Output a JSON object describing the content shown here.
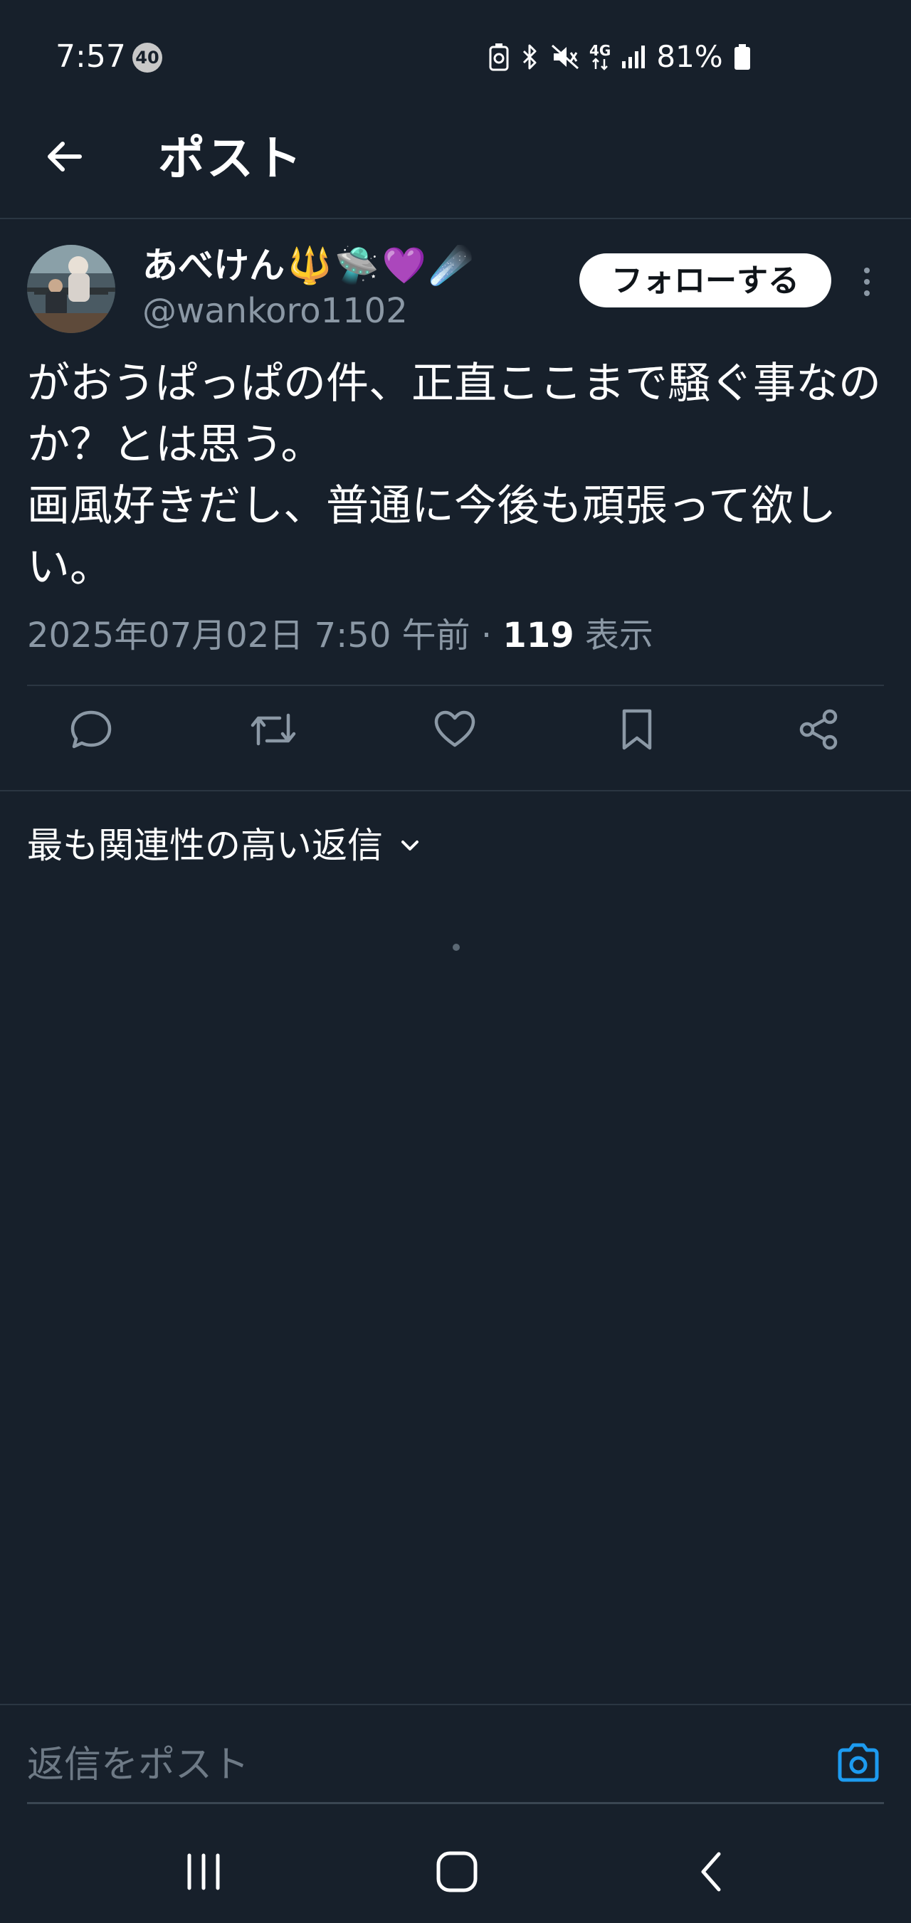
{
  "status_bar": {
    "time": "7:57",
    "notification_count": "40",
    "battery_percent": "81%",
    "network_label": "4G",
    "icons": [
      "battery-saver-icon",
      "bluetooth-icon",
      "mute-icon",
      "network-4g-icon",
      "signal-icon",
      "battery-icon"
    ]
  },
  "header": {
    "back_icon": "arrow-left-icon",
    "title": "ポスト"
  },
  "post": {
    "author_name": "あべけん",
    "author_emojis": [
      "🔱",
      "🛸",
      "💜",
      "☄️"
    ],
    "author_handle": "@wankoro1102",
    "follow_label": "フォローする",
    "text": "がおうぱっぱの件、正直ここまで騒ぐ事なのか？とは思う。\n画風好きだし、普通に今後も頑張って欲しい。",
    "timestamp": "2025年07月02日 7:50 午前",
    "separator": "·",
    "views_count": "119",
    "views_label": "表示"
  },
  "actions": [
    {
      "name": "reply",
      "icon": "reply-icon"
    },
    {
      "name": "repost",
      "icon": "repost-icon"
    },
    {
      "name": "like",
      "icon": "heart-icon"
    },
    {
      "name": "bookmark",
      "icon": "bookmark-icon"
    },
    {
      "name": "share",
      "icon": "share-icon"
    }
  ],
  "replies": {
    "sort_label": "最も関連性の高い返信",
    "sort_icon": "chevron-down-icon"
  },
  "composer": {
    "placeholder": "返信をポスト",
    "camera_icon": "camera-icon"
  },
  "navigation_bar": {
    "icons": [
      "recent-apps-icon",
      "home-icon",
      "back-icon"
    ]
  },
  "colors": {
    "background": "#17202b",
    "text_primary": "#ffffff",
    "text_secondary": "#8b98a5",
    "accent": "#1d9bf0",
    "divider": "#2b3642"
  }
}
